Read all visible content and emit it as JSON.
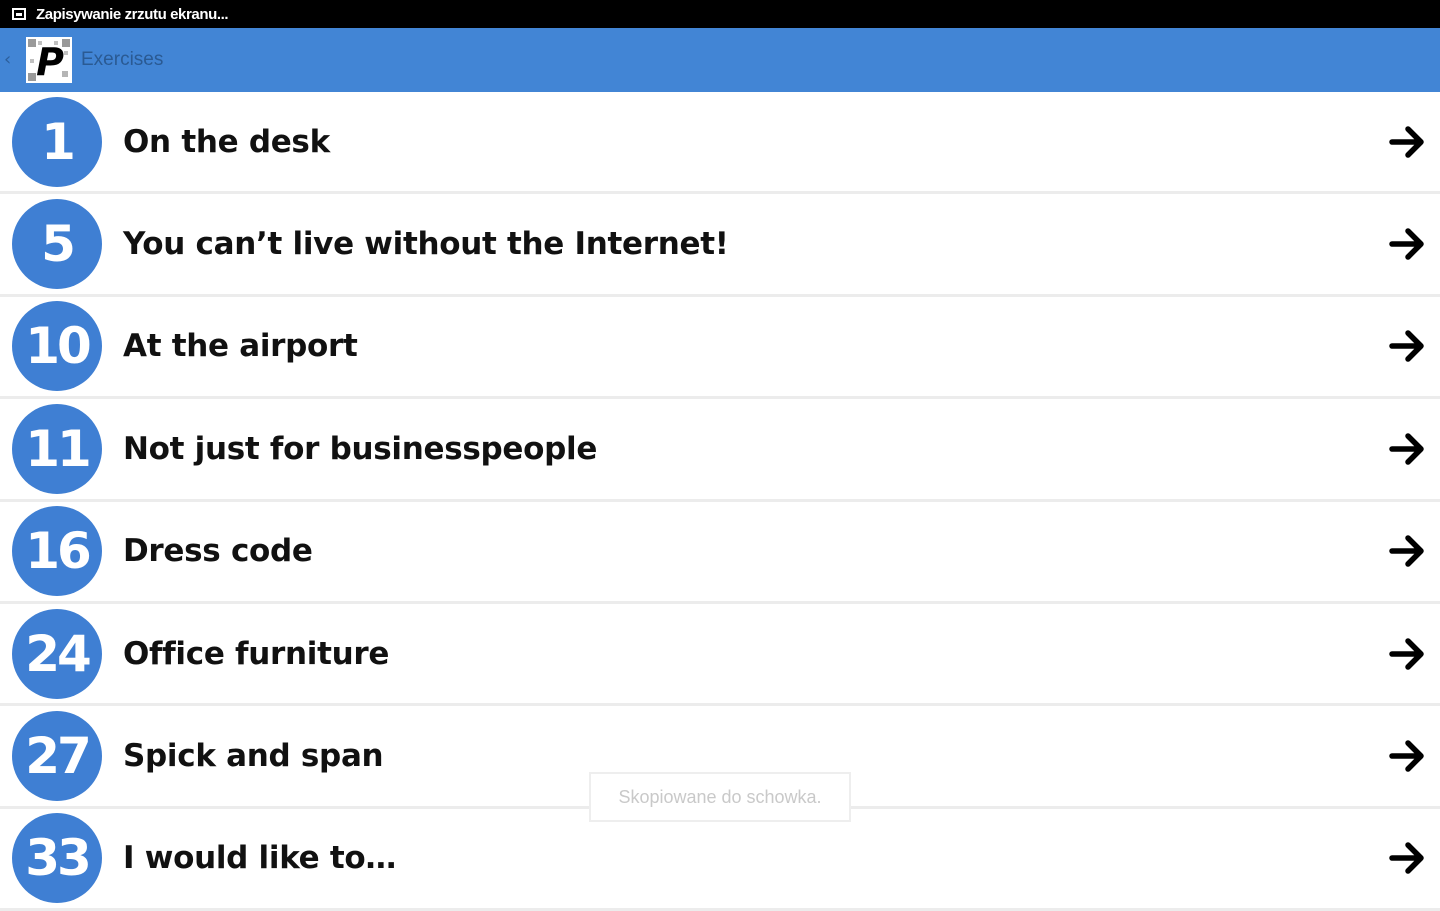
{
  "status_bar": {
    "icon": "screenshot-icon",
    "text": "Zapisywanie zrzutu ekranu..."
  },
  "action_bar": {
    "up_icon": "chevron-left-icon",
    "logo_letter": "P",
    "title": "Exercises",
    "color": "#4285d5"
  },
  "exercises": [
    {
      "number": "1",
      "title": "On the desk"
    },
    {
      "number": "5",
      "title": "You can’t live without the Internet!"
    },
    {
      "number": "10",
      "title": "At the airport"
    },
    {
      "number": "11",
      "title": "Not just for businesspeople"
    },
    {
      "number": "16",
      "title": "Dress code"
    },
    {
      "number": "24",
      "title": "Office furniture"
    },
    {
      "number": "27",
      "title": "Spick and span"
    },
    {
      "number": "33",
      "title": "I would like to…"
    }
  ],
  "row_icon": "arrow-right-icon",
  "badge_color": "#3f7fd3",
  "toast": {
    "text": "Skopiowane do schowka."
  }
}
